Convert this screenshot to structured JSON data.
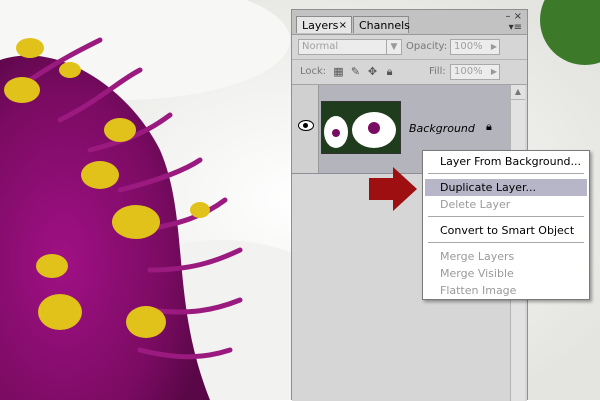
{
  "panel": {
    "tabs": [
      {
        "label": "Layers",
        "close": "×"
      },
      {
        "label": "Channels"
      }
    ],
    "window_buttons": "– ×",
    "menu_icon": "▾≡",
    "blend_mode": "Normal",
    "opacity": {
      "label": "Opacity:",
      "value": "100%"
    },
    "lock_label": "Lock:",
    "fill": {
      "label": "Fill:",
      "value": "100%"
    },
    "layer": {
      "name": "Background",
      "visible": true,
      "locked": true
    }
  },
  "context_menu": {
    "items": [
      {
        "label": "Layer From Background...",
        "enabled": true
      },
      {
        "label": "Duplicate Layer...",
        "enabled": true,
        "highlighted": true
      },
      {
        "label": "Delete Layer",
        "enabled": false
      },
      {
        "label": "Convert to Smart Object",
        "enabled": true
      },
      {
        "label": "Merge Layers",
        "enabled": false
      },
      {
        "label": "Merge Visible",
        "enabled": false
      },
      {
        "label": "Flatten Image",
        "enabled": false
      }
    ]
  },
  "colors": {
    "arrow": "#9e0f12",
    "highlight": "#b6b6c8",
    "flower_center": "#8a0f6e",
    "stamen": "#e0c21a"
  }
}
